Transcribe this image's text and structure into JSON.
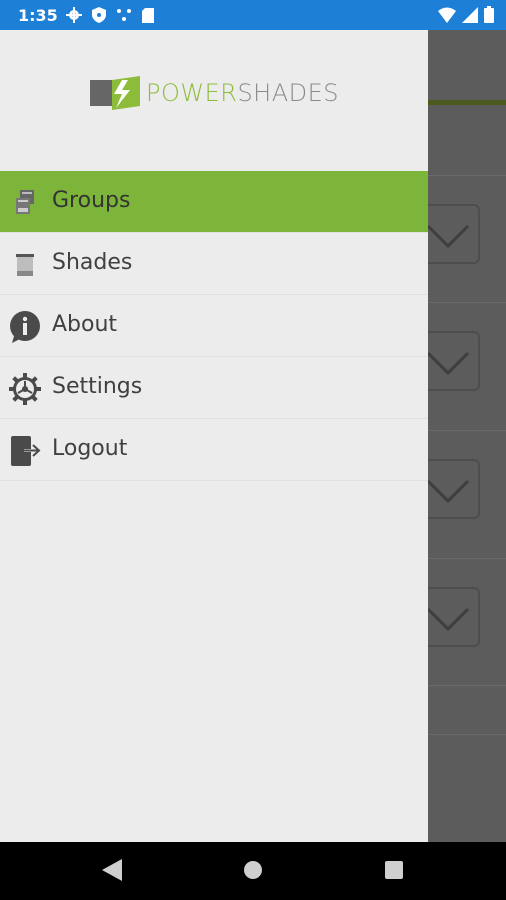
{
  "status_bar": {
    "time": "1:35",
    "left_icons": [
      "settings-gear-icon",
      "shield-icon",
      "network-icon",
      "sd-card-icon"
    ],
    "right_icons": [
      "wifi-icon",
      "signal-icon",
      "battery-icon"
    ]
  },
  "drawer": {
    "logo": {
      "word1": "POWER",
      "word2": "SHADES"
    },
    "menu": [
      {
        "label": "Groups",
        "icon": "groups-icon",
        "active": true
      },
      {
        "label": "Shades",
        "icon": "shade-icon",
        "active": false
      },
      {
        "label": "About",
        "icon": "info-icon",
        "active": false
      },
      {
        "label": "Settings",
        "icon": "gear-icon",
        "active": false
      },
      {
        "label": "Logout",
        "icon": "logout-icon",
        "active": false
      }
    ]
  },
  "colors": {
    "status_bar": "#1d7fd6",
    "accent": "#7db53a",
    "drawer_bg": "#ececec"
  },
  "nav_bar": {
    "buttons": [
      "back-icon",
      "home-icon",
      "recents-icon"
    ]
  }
}
